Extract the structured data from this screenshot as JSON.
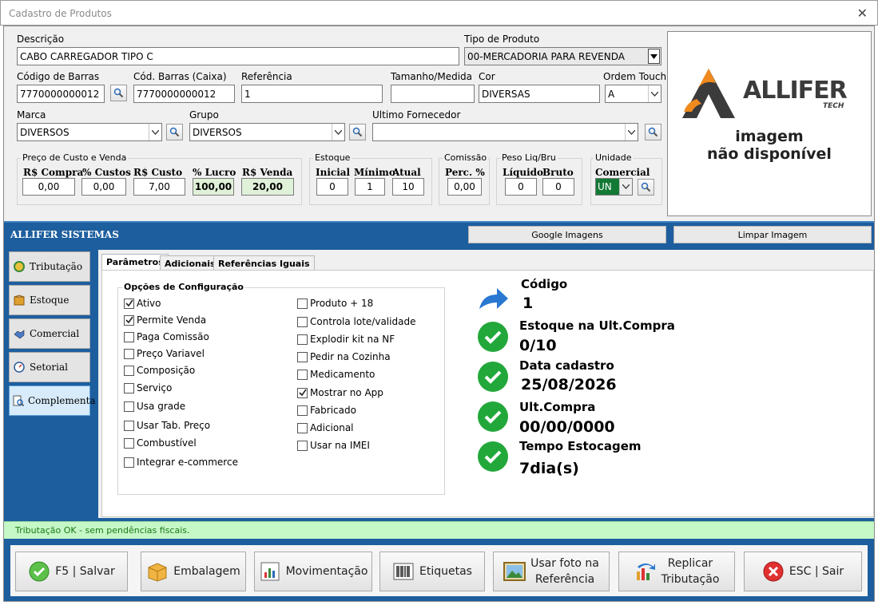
{
  "window": {
    "title": "Cadastro de Produtos",
    "close_glyph": "✕"
  },
  "form": {
    "descricao": {
      "label": "Descrição",
      "value": "CABO CARREGADOR TIPO C"
    },
    "tipo_produto": {
      "label": "Tipo de Produto",
      "value": "00-MERCADORIA PARA REVENDA"
    },
    "codigo_barras": {
      "label": "Código de Barras",
      "value": "7770000000012"
    },
    "cod_barras_caixa": {
      "label": "Cód. Barras (Caixa)",
      "value": "7770000000012"
    },
    "referencia": {
      "label": "Referência",
      "value": "1"
    },
    "tamanho_medida": {
      "label": "Tamanho/Medida",
      "value": ""
    },
    "cor": {
      "label": "Cor",
      "value": "DIVERSAS"
    },
    "ordem_touch": {
      "label": "Ordem Touch",
      "value": "A"
    },
    "marca": {
      "label": "Marca",
      "value": "DIVERSOS"
    },
    "grupo": {
      "label": "Grupo",
      "value": "DIVERSOS"
    },
    "ultimo_fornecedor": {
      "label": "Ultimo Fornecedor",
      "value": ""
    }
  },
  "preco": {
    "title": "Preço de Custo e Venda",
    "compra": {
      "label": "R$ Compra",
      "value": "0,00"
    },
    "custos": {
      "label": "% Custos",
      "value": "0,00"
    },
    "custo": {
      "label": "R$ Custo",
      "value": "7,00"
    },
    "lucro": {
      "label": "% Lucro",
      "value": "100,00"
    },
    "venda": {
      "label": "R$ Venda",
      "value": "20,00"
    }
  },
  "estoque": {
    "title": "Estoque",
    "inicial": {
      "label": "Inicial",
      "value": "0"
    },
    "minimo": {
      "label": "Mínimo",
      "value": "1"
    },
    "atual": {
      "label": "Atual",
      "value": "10"
    }
  },
  "comissao": {
    "title": "Comissão",
    "perc": {
      "label": "Perc. %",
      "value": "0,00"
    }
  },
  "peso": {
    "title": "Peso Liq/Bru",
    "liquido": {
      "label": "Líquido",
      "value": "0"
    },
    "bruto": {
      "label": "Bruto",
      "value": "0"
    }
  },
  "unidade": {
    "title": "Unidade",
    "comercial": {
      "label": "Comercial",
      "value": "UN"
    }
  },
  "image_panel": {
    "brand": "ALLIFER",
    "brand_sub": "TECH",
    "line1": "imagem",
    "line2": "não disponível"
  },
  "banner": {
    "title": "ALLIFER SISTEMAS",
    "google_btn": "Google Imagens",
    "clear_btn": "Limpar Imagem"
  },
  "nav": {
    "items": [
      {
        "label": "Tributação"
      },
      {
        "label": "Estoque"
      },
      {
        "label": "Comercial"
      },
      {
        "label": "Setorial"
      },
      {
        "label": "Complementar"
      }
    ]
  },
  "tabs": [
    {
      "label": "Parâmetros"
    },
    {
      "label": "Adicionais"
    },
    {
      "label": "Referências Iguais"
    }
  ],
  "config": {
    "title": "Opções de Configuração",
    "col1": [
      {
        "label": "Ativo",
        "checked": true
      },
      {
        "label": "Permite Venda",
        "checked": true
      },
      {
        "label": "Paga Comissão",
        "checked": false
      },
      {
        "label": "Preço Variavel",
        "checked": false
      },
      {
        "label": "Composição",
        "checked": false
      },
      {
        "label": "Serviço",
        "checked": false
      },
      {
        "label": "Usa grade",
        "checked": false
      },
      {
        "label": "Usar Tab. Preço",
        "checked": false
      },
      {
        "label": "Combustível",
        "checked": false
      },
      {
        "label": "Integrar e-commerce",
        "checked": false
      }
    ],
    "col2": [
      {
        "label": "Produto + 18",
        "checked": false
      },
      {
        "label": "Controla lote/validade",
        "checked": false
      },
      {
        "label": "Explodir kit na NF",
        "checked": false
      },
      {
        "label": "Pedir na Cozinha",
        "checked": false
      },
      {
        "label": "Medicamento",
        "checked": false
      },
      {
        "label": "Mostrar no App",
        "checked": true
      },
      {
        "label": "Fabricado",
        "checked": false
      },
      {
        "label": "Adicional",
        "checked": false
      },
      {
        "label": "Usar na IMEI",
        "checked": false
      }
    ]
  },
  "info": {
    "codigo": {
      "label": "Código",
      "value": "1"
    },
    "estoque_ult": {
      "label": "Estoque na Ult.Compra",
      "value": "0/10"
    },
    "data_cadastro": {
      "label": "Data cadastro",
      "value": "25/08/2026"
    },
    "ult_compra": {
      "label": "Ult.Compra",
      "value": "00/00/0000"
    },
    "tempo": {
      "label": "Tempo Estocagem",
      "value": "7dia(s)"
    }
  },
  "status": {
    "text": "Tributação OK - sem pendências fiscais."
  },
  "buttons": {
    "salvar": "F5 | Salvar",
    "embalagem": "Embalagem",
    "movimentacao": "Movimentação",
    "etiquetas": "Etiquetas",
    "usar_foto_1": "Usar foto na",
    "usar_foto_2": "Referência",
    "replicar_1": "Replicar",
    "replicar_2": "Tributação",
    "sair": "ESC | Sair"
  },
  "colors": {
    "accent_blue": "#1d5e9e",
    "ok_green": "#22a83a",
    "status_green": "#c6f7c6"
  }
}
